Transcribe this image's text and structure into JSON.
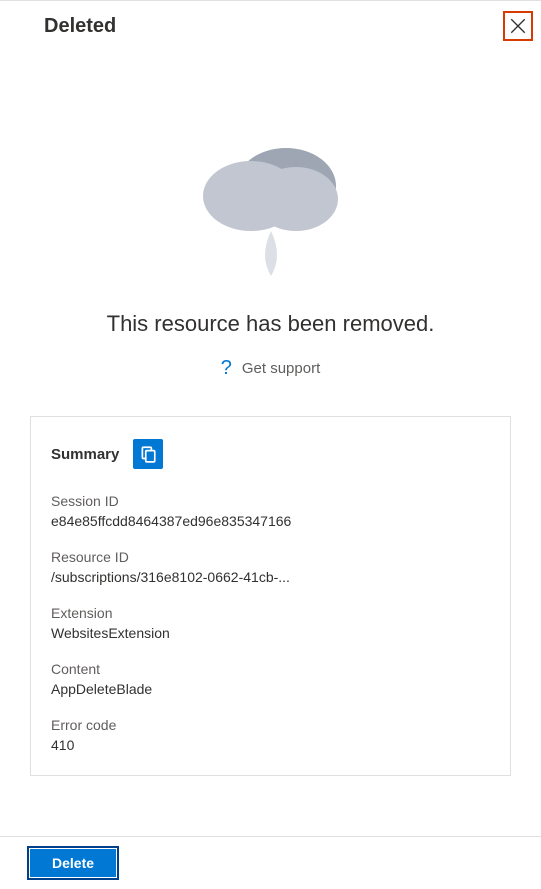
{
  "header": {
    "title": "Deleted"
  },
  "message": "This resource has been removed.",
  "support": {
    "label": "Get support"
  },
  "summary": {
    "title": "Summary",
    "items": [
      {
        "label": "Session ID",
        "value": "e84e85ffcdd8464387ed96e835347166"
      },
      {
        "label": "Resource ID",
        "value": "/subscriptions/316e8102-0662-41cb-..."
      },
      {
        "label": "Extension",
        "value": "WebsitesExtension"
      },
      {
        "label": "Content",
        "value": "AppDeleteBlade"
      },
      {
        "label": "Error code",
        "value": "410"
      }
    ]
  },
  "footer": {
    "delete_label": "Delete"
  }
}
